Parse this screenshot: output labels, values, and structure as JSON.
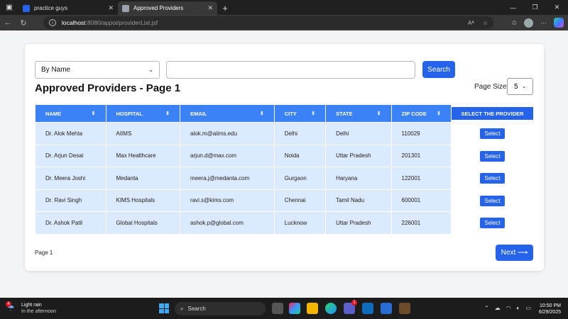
{
  "browser": {
    "tabs": [
      {
        "label": "practice guys",
        "active": false
      },
      {
        "label": "Approved Providers",
        "active": true
      }
    ],
    "url_host": "localhost",
    "url_path": ":8080/appoi/providerList.jsf"
  },
  "search": {
    "filter_value": "By Name",
    "query_value": "",
    "button_label": "Search"
  },
  "page_title": "Approved Providers - Page 1",
  "page_size": {
    "label": "Page Size:",
    "value": "5"
  },
  "table": {
    "columns": [
      "NAME",
      "HOSPITAL",
      "EMAIL",
      "CITY",
      "STATE",
      "ZIP CODE"
    ],
    "select_column": "SELECT THE PROVIDER",
    "select_label": "Select",
    "rows": [
      {
        "name": "Dr. Alok Mehta",
        "hospital": "AIIMS",
        "email": "alok.m@aiims.edu",
        "city": "Delhi",
        "state": "Delhi",
        "zip": "110029"
      },
      {
        "name": "Dr. Arjun Desai",
        "hospital": "Max Healthcare",
        "email": "arjun.d@max.com",
        "city": "Noida",
        "state": "Uttar Pradesh",
        "zip": "201301"
      },
      {
        "name": "Dr. Meera Joshi",
        "hospital": "Medanta",
        "email": "meera.j@medanta.com",
        "city": "Gurgaon",
        "state": "Haryana",
        "zip": "122001"
      },
      {
        "name": "Dr. Ravi Singh",
        "hospital": "KIMS Hospitals",
        "email": "ravi.s@kims.com",
        "city": "Chennai",
        "state": "Tamil Nadu",
        "zip": "600001"
      },
      {
        "name": "Dr. Ashok Patil",
        "hospital": "Global Hospitals",
        "email": "ashok.p@global.com",
        "city": "Lucknow",
        "state": "Uttar Pradesh",
        "zip": "226001"
      }
    ]
  },
  "footer": {
    "page_info": "Page 1",
    "next_label": "Next ⟶"
  },
  "taskbar": {
    "weather_title": "Light rain",
    "weather_sub": "In the afternoon",
    "weather_badge": "4",
    "search_label": "Search",
    "teams_badge": "1",
    "time": "10:50 PM",
    "date": "6/29/2025"
  }
}
